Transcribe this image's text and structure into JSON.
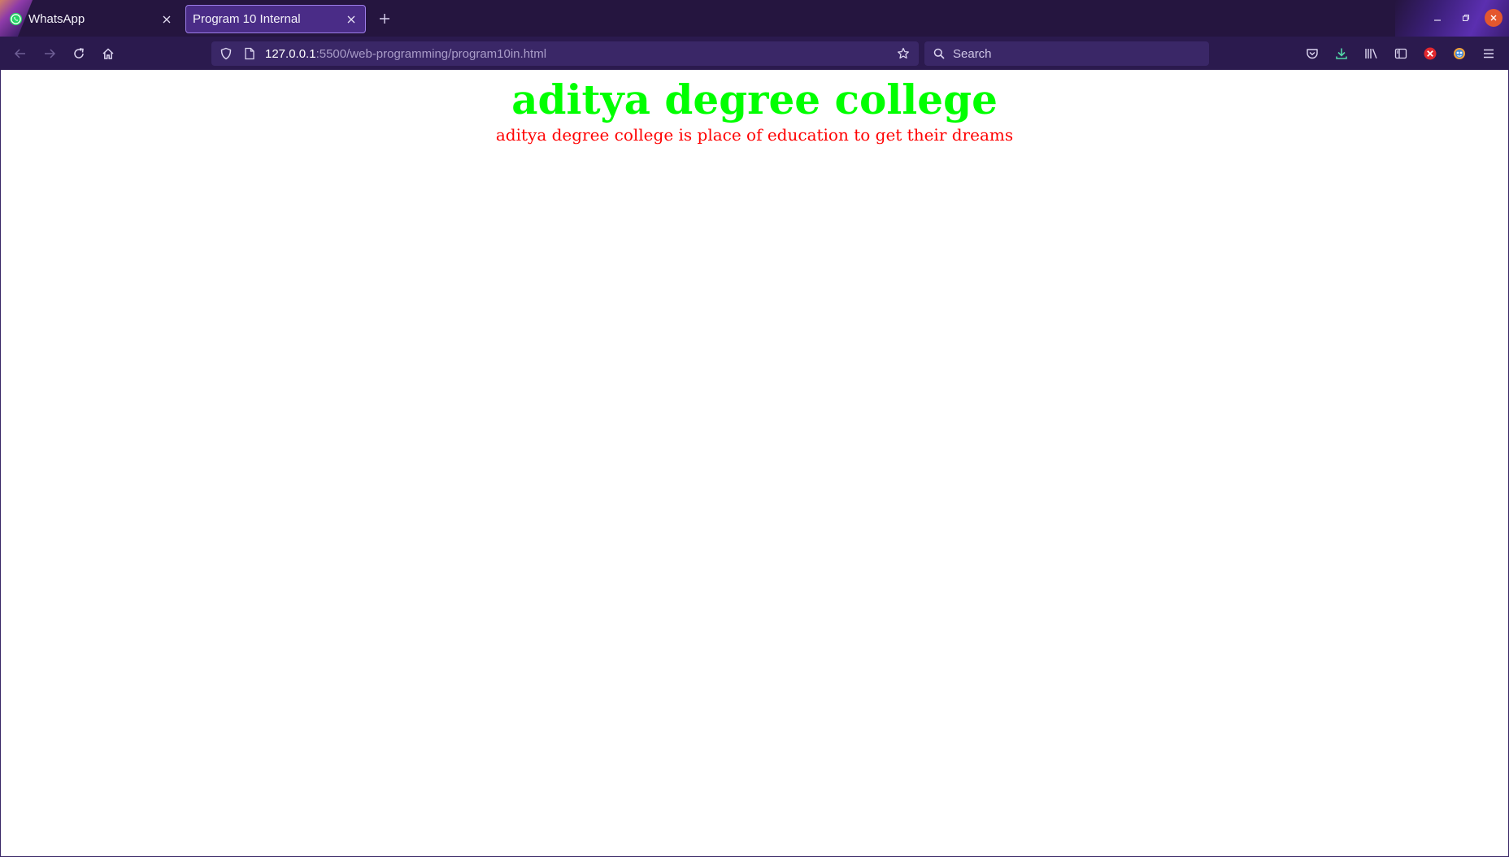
{
  "browser": {
    "tabs": [
      {
        "label": "WhatsApp",
        "icon": "whatsapp-icon",
        "active": false
      },
      {
        "label": "Program 10 Internal",
        "icon": "",
        "active": true
      }
    ],
    "url": {
      "host": "127.0.0.1",
      "path": ":5500/web-programming/program10in.html"
    },
    "search": {
      "placeholder": "Search"
    },
    "colors": {
      "tabstrip": "#25153f",
      "navbar": "#2b1a4e",
      "active_tab": "#4a2c87",
      "field": "#3a2767"
    }
  },
  "page": {
    "heading": "aditya degree college",
    "tagline": "aditya degree college is place of education to get their dreams",
    "colors": {
      "heading": "#00ff00",
      "tagline": "#ff0000"
    }
  }
}
